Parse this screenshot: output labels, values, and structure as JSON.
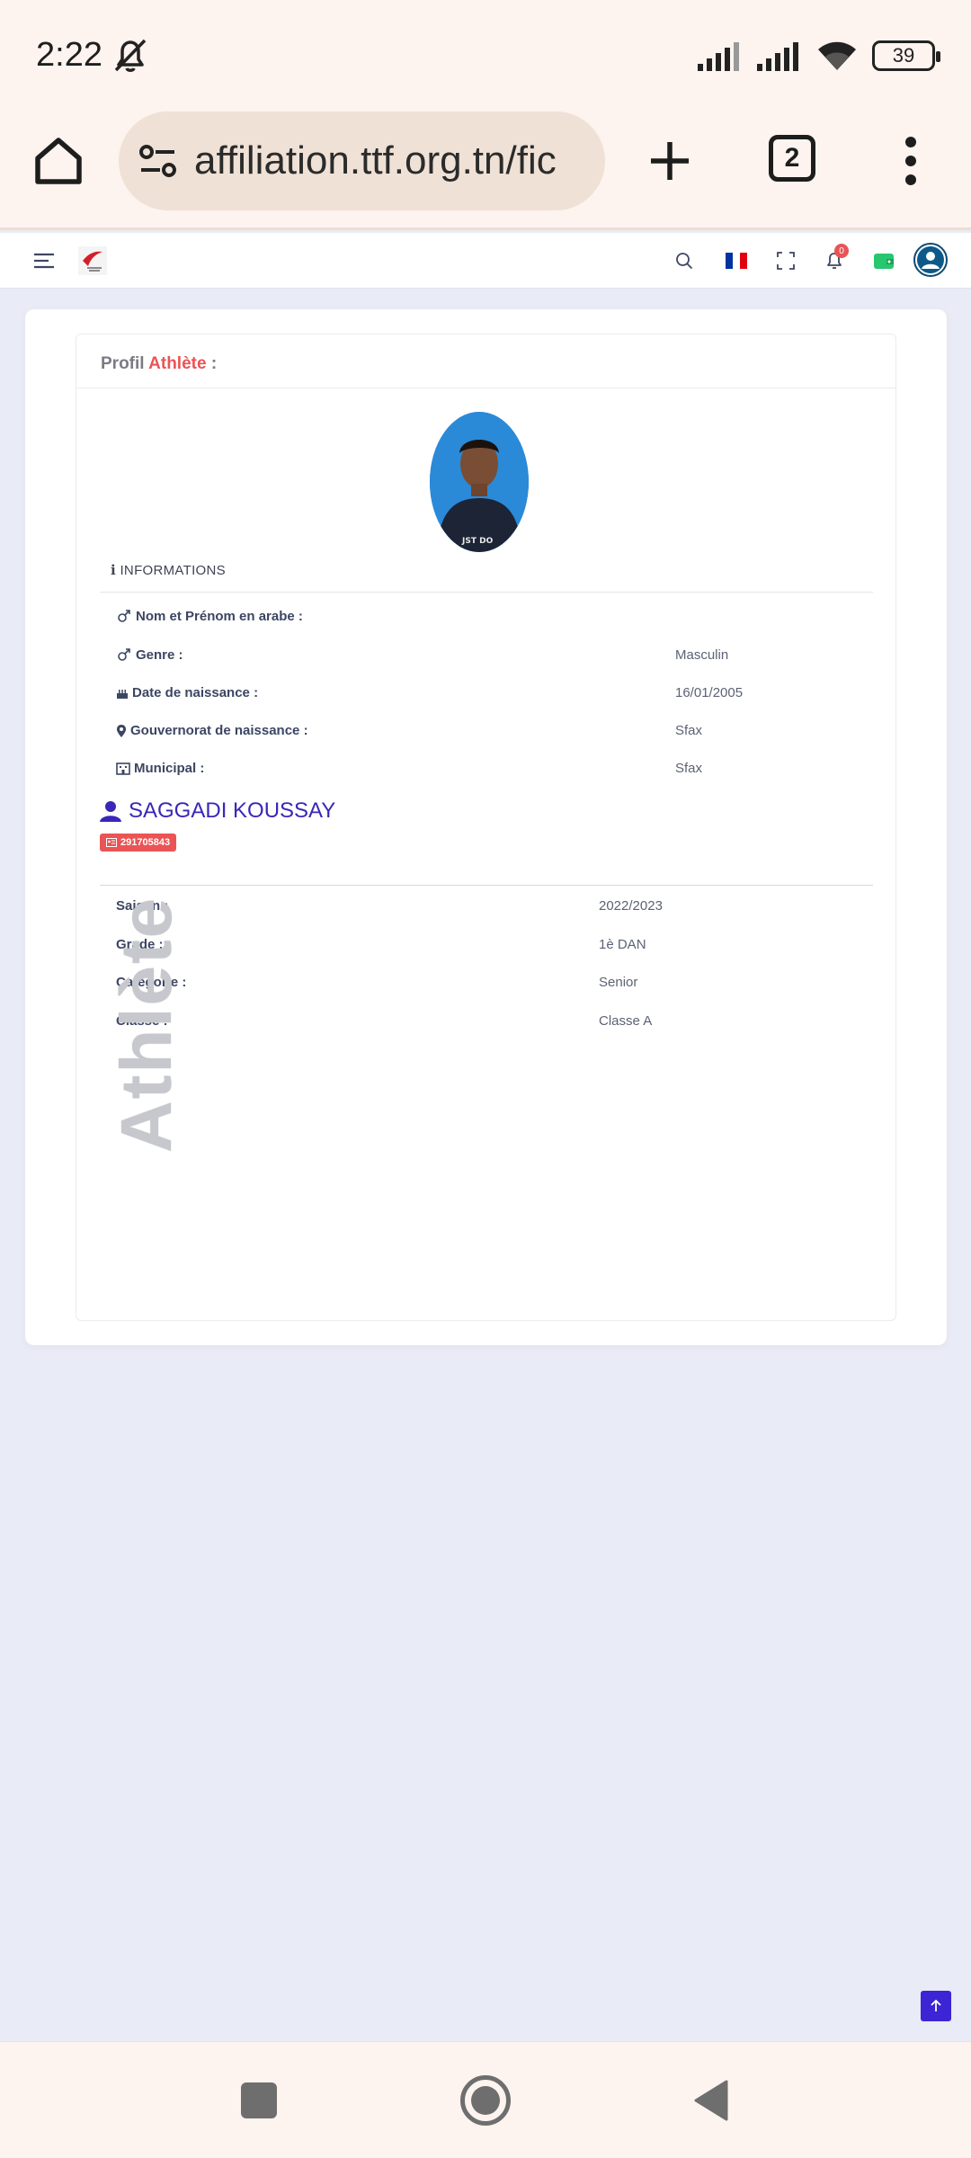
{
  "status_bar": {
    "time": "2:22",
    "battery": "39"
  },
  "browser": {
    "url": "affiliation.ttf.org.tn/fic",
    "tab_count": "2"
  },
  "site_nav": {
    "notification_count": "0"
  },
  "profile": {
    "header_prefix": "Profil ",
    "header_accent": "Athlète",
    "header_suffix": " :",
    "section_title": "INFORMATIONS",
    "info_rows": [
      {
        "icon": "gender-icon",
        "label": "Nom et Prénom en arabe :",
        "value": ""
      },
      {
        "icon": "gender-icon",
        "label": "Genre :",
        "value": "Masculin"
      },
      {
        "icon": "birthday-cake-icon",
        "label": "Date de naissance :",
        "value": "16/01/2005"
      },
      {
        "icon": "map-marker-icon",
        "label": "Gouvernorat de naissance :",
        "value": "Sfax"
      },
      {
        "icon": "building-icon",
        "label": "Municipal :",
        "value": "Sfax"
      }
    ],
    "athlete_name": "SAGGADI KOUSSAY",
    "license_number": "291705843",
    "season_rows": [
      {
        "label": "Saison :",
        "value": "2022/2023"
      },
      {
        "label": "Grade :",
        "value": "1è DAN"
      },
      {
        "label": "Catégorie :",
        "value": "Senior"
      },
      {
        "label": "Classe :",
        "value": "Classe A"
      }
    ],
    "watermark": "Athlète"
  },
  "colors": {
    "accent": "#ea5455",
    "primary": "#3a27b8",
    "page_bg": "#e9ebf6"
  }
}
